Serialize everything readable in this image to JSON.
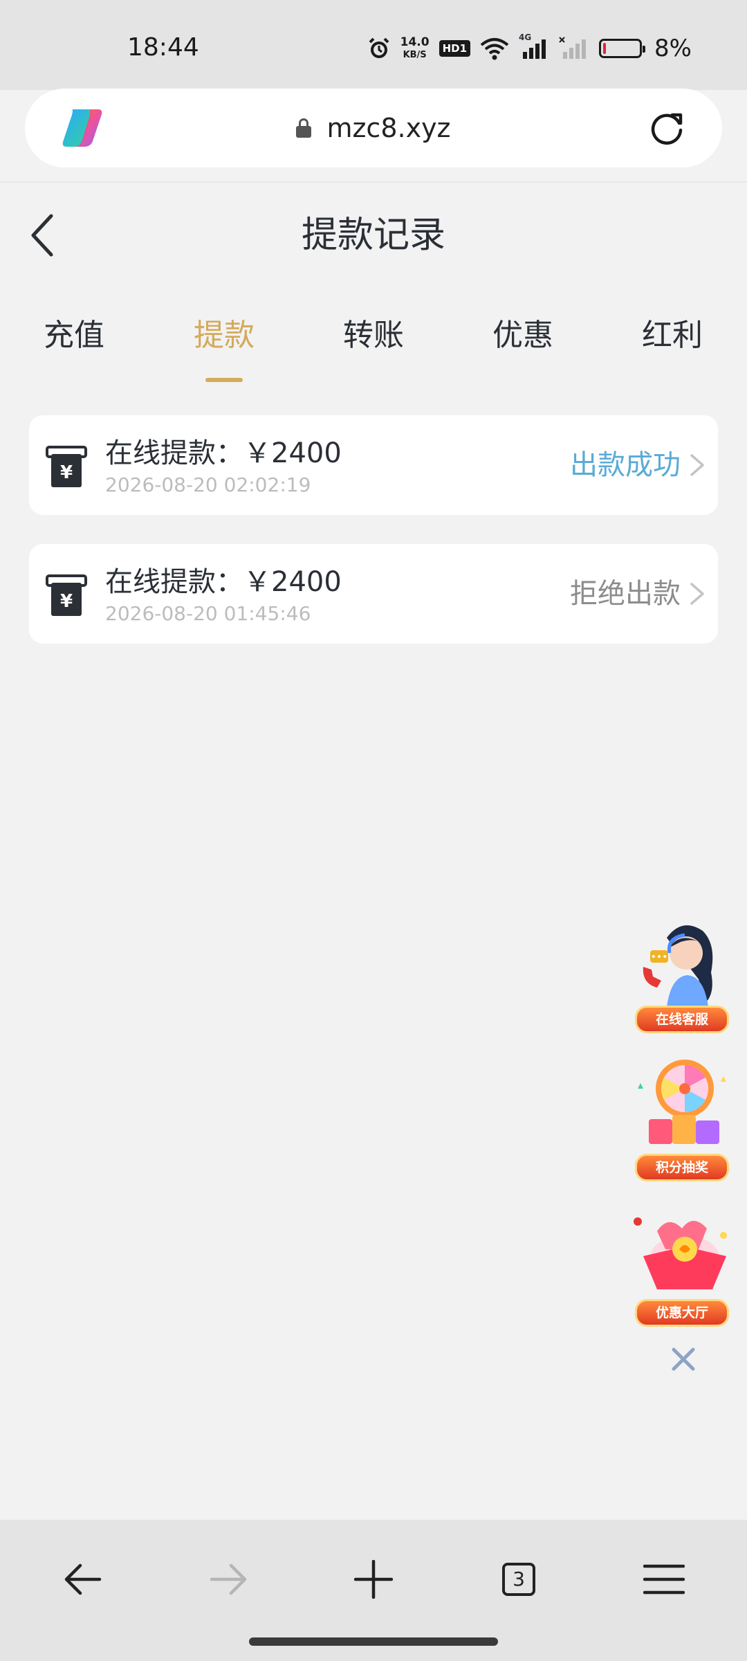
{
  "status_bar": {
    "time": "18:44",
    "net_speed_value": "14.0",
    "net_speed_unit": "KB/S",
    "hd_label": "HD1",
    "signal_label": "4G",
    "battery_percent": "8%",
    "battery_level": 0.08,
    "battery_color": "#e0243a",
    "icons": [
      "alarm-icon",
      "hd-icon",
      "wifi-icon",
      "signal-4g-icon",
      "signal-no-service-icon",
      "battery-icon"
    ]
  },
  "browser": {
    "url": "mzc8.xyz",
    "icons": [
      "copilot-logo-icon",
      "lock-icon",
      "reload-icon"
    ]
  },
  "header": {
    "title": "提款记录",
    "back_icon": "chevron-left-icon"
  },
  "tabs": [
    {
      "label": "充值",
      "active": false
    },
    {
      "label": "提款",
      "active": true
    },
    {
      "label": "转账",
      "active": false
    },
    {
      "label": "优惠",
      "active": false
    },
    {
      "label": "红利",
      "active": false
    }
  ],
  "accent_color": "#d4aa5b",
  "records": [
    {
      "title": "在线提款：￥2400",
      "time": "2026-08-20 02:02:19",
      "status": "出款成功",
      "status_color": "#5aaad6",
      "icon": "withdraw-atm-icon"
    },
    {
      "title": "在线提款：￥2400",
      "time": "2026-08-20 01:45:46",
      "status": "拒绝出款",
      "status_color": "#8c8c8c",
      "icon": "withdraw-atm-icon"
    }
  ],
  "floating": [
    {
      "label": "在线客服",
      "icon": "customer-service-agent-icon"
    },
    {
      "label": "积分抽奖",
      "icon": "prize-wheel-icon"
    },
    {
      "label": "优惠大厅",
      "icon": "gift-box-icon"
    }
  ],
  "bottom_nav": {
    "tab_count": "3",
    "icons": [
      "back-arrow-icon",
      "forward-arrow-icon",
      "new-tab-plus-icon",
      "tab-switcher-icon",
      "menu-icon"
    ]
  }
}
